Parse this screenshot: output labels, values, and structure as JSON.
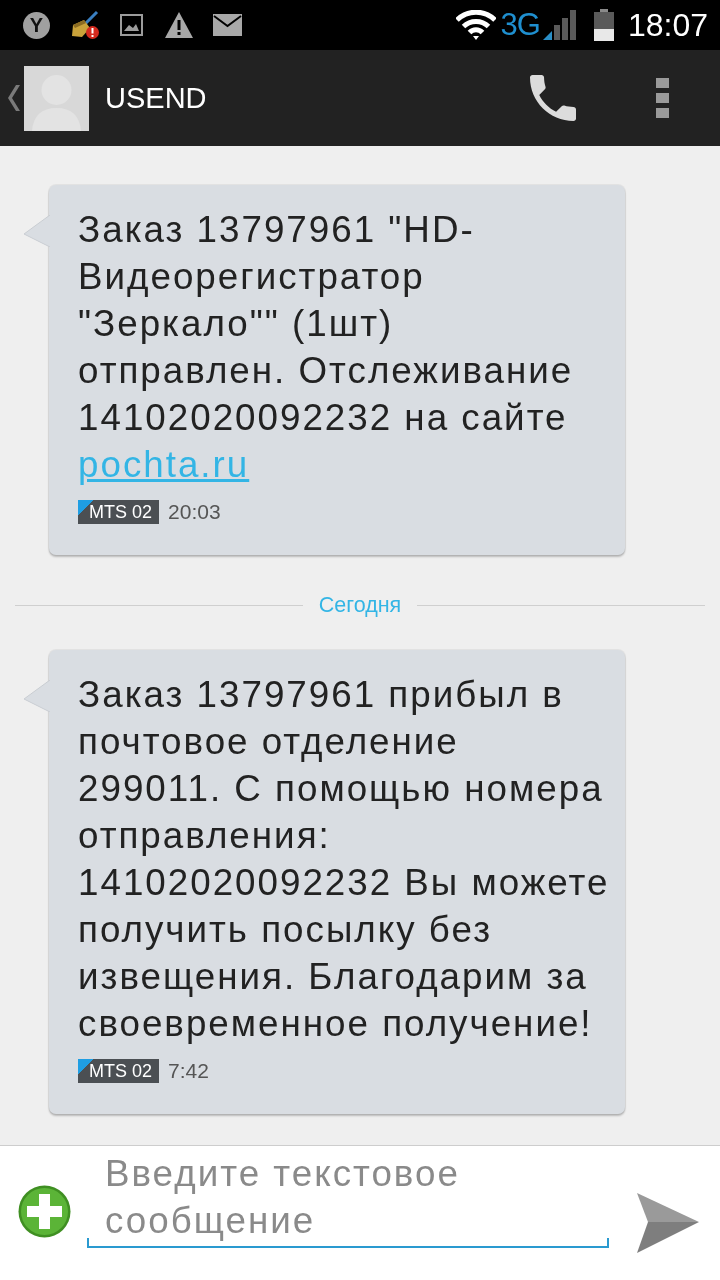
{
  "status_bar": {
    "notifications": [
      {
        "kind": "app_letter",
        "text": "Y"
      },
      {
        "kind": "cleaner"
      },
      {
        "kind": "image"
      },
      {
        "kind": "warning"
      },
      {
        "kind": "mail"
      }
    ],
    "network_type": "3G",
    "time": "18:07"
  },
  "action_bar": {
    "contact_name": "USEND"
  },
  "conversation": [
    {
      "kind": "message",
      "text": "Заказ 13797961 \"HD-Видеорегистратор \"Зеркало\"\" (1шт) отправлен. Отслеживание 14102020092232 на сайте",
      "link": "pochta.ru",
      "sim": "MTS 02",
      "time": "20:03"
    },
    {
      "kind": "date_divider",
      "label": "Сегодня"
    },
    {
      "kind": "message",
      "text": "Заказ 13797961 прибыл в почтовое отделение 299011. С помощью номера отправления: 14102020092232 Вы можете получить посылку без извещения. Благодарим за своевременное получение!",
      "sim": "MTS 02",
      "time": "7:42"
    }
  ],
  "composer": {
    "placeholder": "Введите текстовое сообщение"
  }
}
